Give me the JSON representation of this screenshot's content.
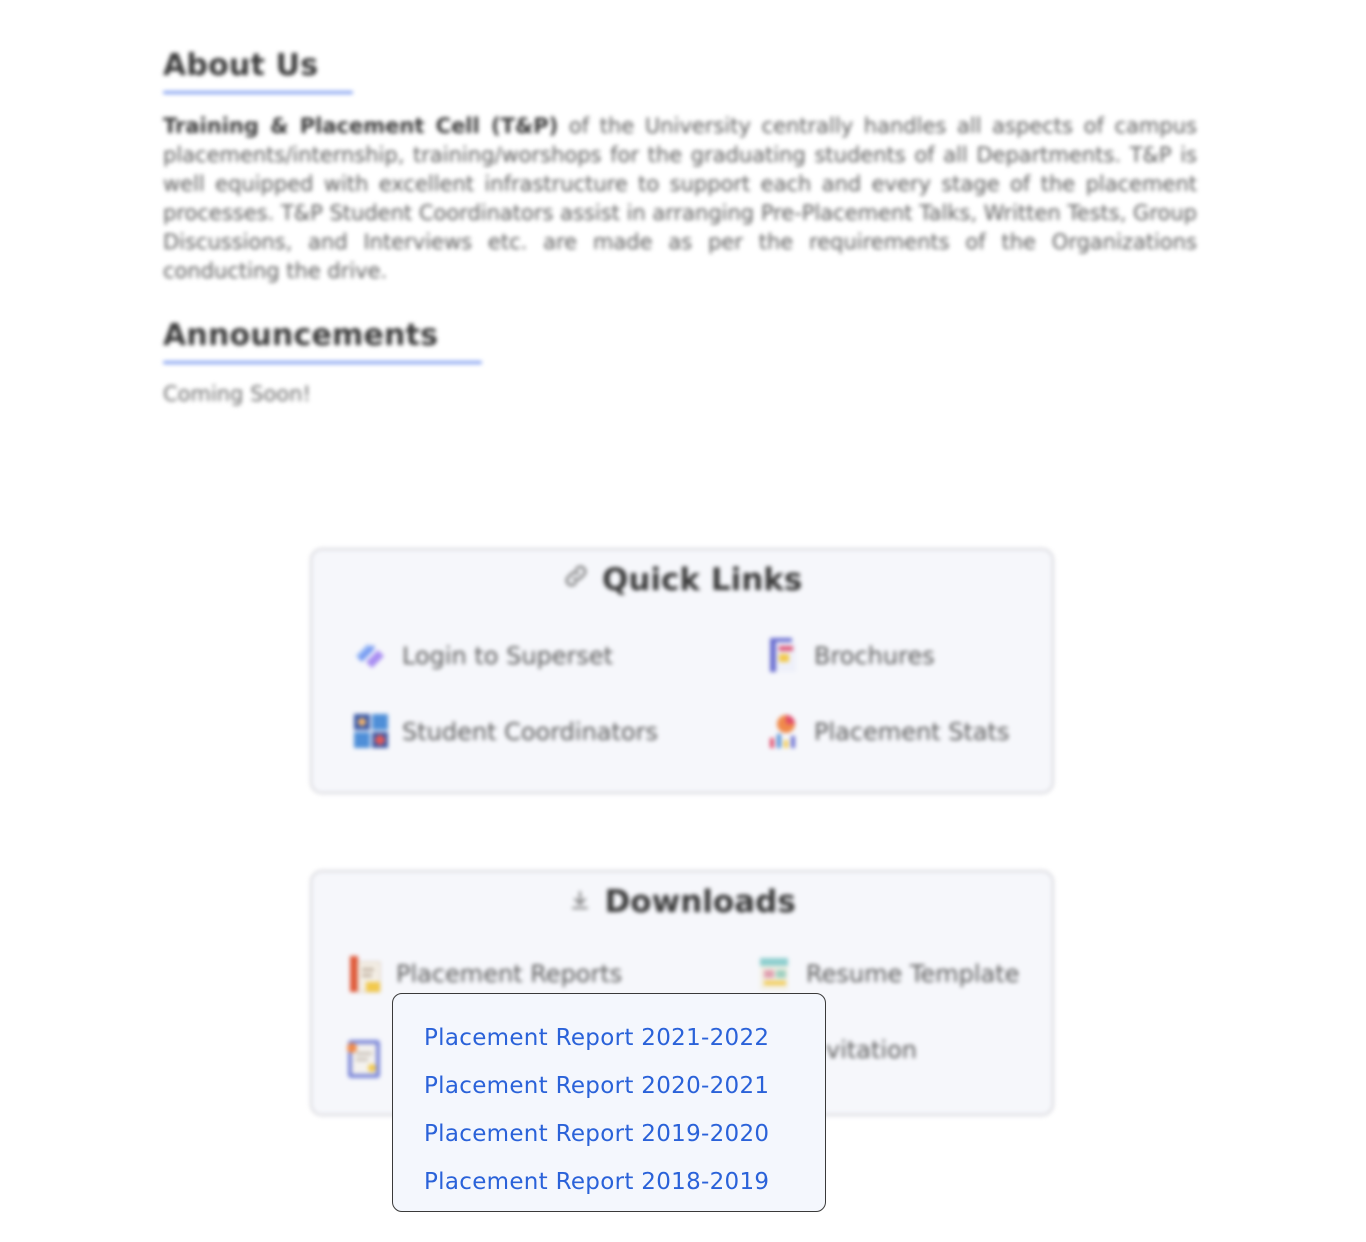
{
  "about": {
    "heading": "About Us",
    "lead_bold": "Training & Placement Cell (T&P)",
    "body": " of the University centrally handles all aspects of campus placements/internship, training/worshops for the graduating students of all Departments. T&P is well equipped with excellent infrastructure to support each and every stage of the placement processes. T&P Student Coordinators assist in arranging Pre-Placement Talks, Written Tests, Group Discussions, and Interviews etc. are made as per the requirements of the Organizations conducting the drive."
  },
  "announcements": {
    "heading": "Announcements",
    "text": "Coming Soon!"
  },
  "quick_links": {
    "title": "Quick Links",
    "icon": "link-icon",
    "items": [
      {
        "label": "Login to Superset",
        "icon": "superset-logo-icon"
      },
      {
        "label": "Brochures",
        "icon": "brochure-icon"
      },
      {
        "label": "Student Coordinators",
        "icon": "coordinators-icon"
      },
      {
        "label": "Placement Stats",
        "icon": "stats-chart-icon"
      }
    ]
  },
  "downloads": {
    "title": "Downloads",
    "icon": "download-icon",
    "items": [
      {
        "label": "Placement Reports",
        "icon": "report-icon"
      },
      {
        "label": "Resume Template",
        "icon": "resume-icon"
      },
      {
        "label": "",
        "icon": "clipboard-icon"
      },
      {
        "label": "vitation",
        "icon": ""
      }
    ]
  },
  "dropdown": {
    "items": [
      "Placement Report 2021-2022",
      "Placement Report 2020-2021",
      "Placement Report 2019-2020",
      "Placement Report 2018-2019"
    ]
  },
  "colors": {
    "accent_underline": "#7f9df0",
    "link_blue": "#2a62d9",
    "card_bg": "#f6f7fb"
  }
}
